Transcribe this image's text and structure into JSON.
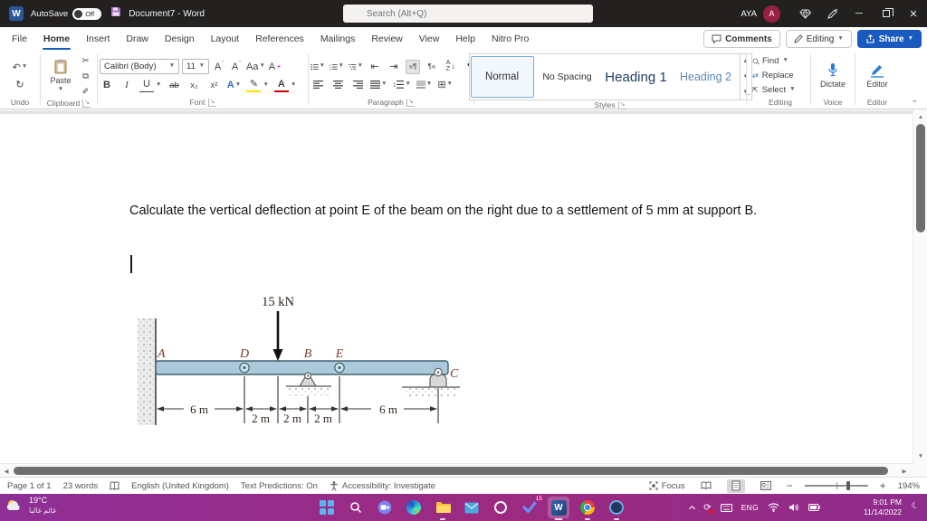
{
  "titlebar": {
    "autosave_label": "AutoSave",
    "autosave_state": "Off",
    "doc_title": "Document7 - Word",
    "search_placeholder": "Search (Alt+Q)",
    "user_name": "AYA",
    "user_initial": "A"
  },
  "tabs": {
    "items": [
      "File",
      "Home",
      "Insert",
      "Draw",
      "Design",
      "Layout",
      "References",
      "Mailings",
      "Review",
      "View",
      "Help",
      "Nitro Pro"
    ],
    "comments_label": "Comments",
    "editing_label": "Editing",
    "share_label": "Share"
  },
  "ribbon": {
    "undo_group": "Undo",
    "clipboard": {
      "paste_label": "Paste",
      "group": "Clipboard"
    },
    "font": {
      "name": "Calibri (Body)",
      "size": "11",
      "group": "Font",
      "bold": "B",
      "italic": "I",
      "underline": "U",
      "strike": "ab",
      "subscript": "x₂",
      "superscript": "x²",
      "grow": "A",
      "shrink": "A",
      "change_case": "Aa",
      "clear": "A",
      "effects": "A",
      "color": "A"
    },
    "paragraph": {
      "group": "Paragraph",
      "sort": "A↓",
      "pilcrow": "¶"
    },
    "styles": {
      "group": "Styles",
      "items": [
        "Normal",
        "No Spacing",
        "Heading 1",
        "Heading 2"
      ]
    },
    "editing": {
      "group": "Editing",
      "find": "Find",
      "replace": "Replace",
      "select": "Select"
    },
    "voice": {
      "group": "Voice",
      "dictate": "Dictate"
    },
    "editor": {
      "group": "Editor",
      "button": "Editor"
    }
  },
  "document": {
    "paragraph": "Calculate the vertical deflection at point E of the beam on the right due to a settlement of 5 mm at support B."
  },
  "figure": {
    "load_label": "15 kN",
    "point_a": "A",
    "point_d": "D",
    "point_b": "B",
    "point_e": "E",
    "point_c": "C",
    "dim_ad": "6 m",
    "dim_d_load": "2 m",
    "dim_load_b": "2 m",
    "dim_b_e": "2 m",
    "dim_e_c": "6 m"
  },
  "statusbar": {
    "page": "Page 1 of 1",
    "words": "23 words",
    "language": "English (United Kingdom)",
    "predictions": "Text Predictions: On",
    "accessibility": "Accessibility: Investigate",
    "focus": "Focus",
    "zoom_level": "194%"
  },
  "taskbar": {
    "temperature": "19°C",
    "weather_condition": "غائم غالبا",
    "badge_count": "15",
    "language": "ENG",
    "time": "9:01 PM",
    "date": "11/14/2022"
  },
  "colors": {
    "accent_blue": "#185abd",
    "taskbar_purple": "#8e2f96",
    "beam_fill": "#aac9da",
    "figure_label_maroon": "#7b3a2a"
  }
}
